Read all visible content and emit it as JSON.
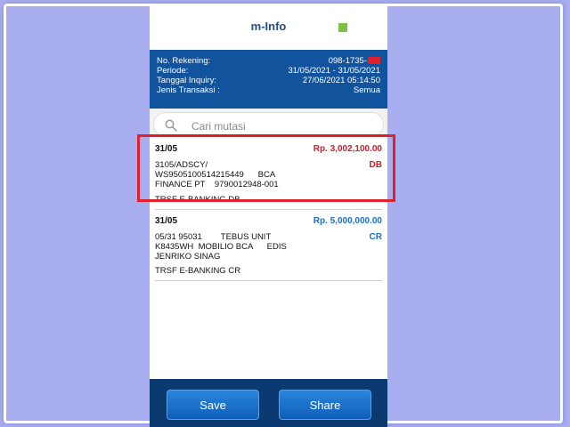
{
  "header": {
    "title": "m-Info",
    "status_color": "#7dc242"
  },
  "info": {
    "rows": [
      {
        "label": "No. Rekening:",
        "value": "098-1735-"
      },
      {
        "label": "Periode:",
        "value": "31/05/2021 - 31/05/2021"
      },
      {
        "label": "Tanggal Inquiry:",
        "value": "27/06/2021 05:14:50"
      },
      {
        "label": "Jenis Transaksi :",
        "value": "Semua"
      }
    ]
  },
  "search": {
    "placeholder": "Cari mutasi",
    "value": ""
  },
  "transactions": [
    {
      "date": "31/05",
      "amount": "Rp. 3,002,100.00",
      "type": "DB",
      "desc": "3105/ADSCY/\nWS9505100514215449      BCA\nFINANCE PT    9790012948-001",
      "kind": "TRSF E-BANKING DB"
    },
    {
      "date": "31/05",
      "amount": "Rp. 5,000,000.00",
      "type": "CR",
      "desc": "05/31 95031        TEBUS UNIT\nK8435WH  MOBILIO BCA      EDIS\nJENRIKO SINAG",
      "kind": "TRSF E-BANKING CR"
    }
  ],
  "footer": {
    "save_label": "Save",
    "share_label": "Share"
  },
  "colors": {
    "debit": "#c8202a",
    "credit": "#1a6fc2",
    "header_blue": "#11539d",
    "footer_blue": "#0b3a70"
  }
}
